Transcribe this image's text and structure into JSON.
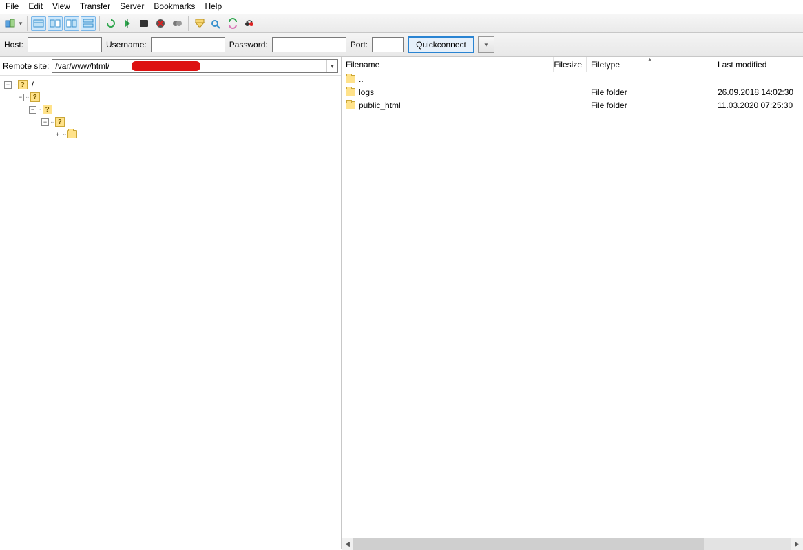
{
  "menu": {
    "file": "File",
    "edit": "Edit",
    "view": "View",
    "transfer": "Transfer",
    "server": "Server",
    "bookmarks": "Bookmarks",
    "help": "Help"
  },
  "quickbar": {
    "host_label": "Host:",
    "username_label": "Username:",
    "password_label": "Password:",
    "port_label": "Port:",
    "connect_label": "Quickconnect",
    "host_value": "",
    "username_value": "",
    "password_value": "",
    "port_value": ""
  },
  "remote_site_label": "Remote site:",
  "remote_site_value": "/var/www/html/",
  "tree": {
    "root": "/"
  },
  "columns": {
    "filename": "Filename",
    "filesize": "Filesize",
    "filetype": "Filetype",
    "last_modified": "Last modified"
  },
  "files": [
    {
      "name": "..",
      "size": "",
      "type": "",
      "modified": ""
    },
    {
      "name": "logs",
      "size": "",
      "type": "File folder",
      "modified": "26.09.2018 14:02:30"
    },
    {
      "name": "public_html",
      "size": "",
      "type": "File folder",
      "modified": "11.03.2020 07:25:30"
    }
  ]
}
